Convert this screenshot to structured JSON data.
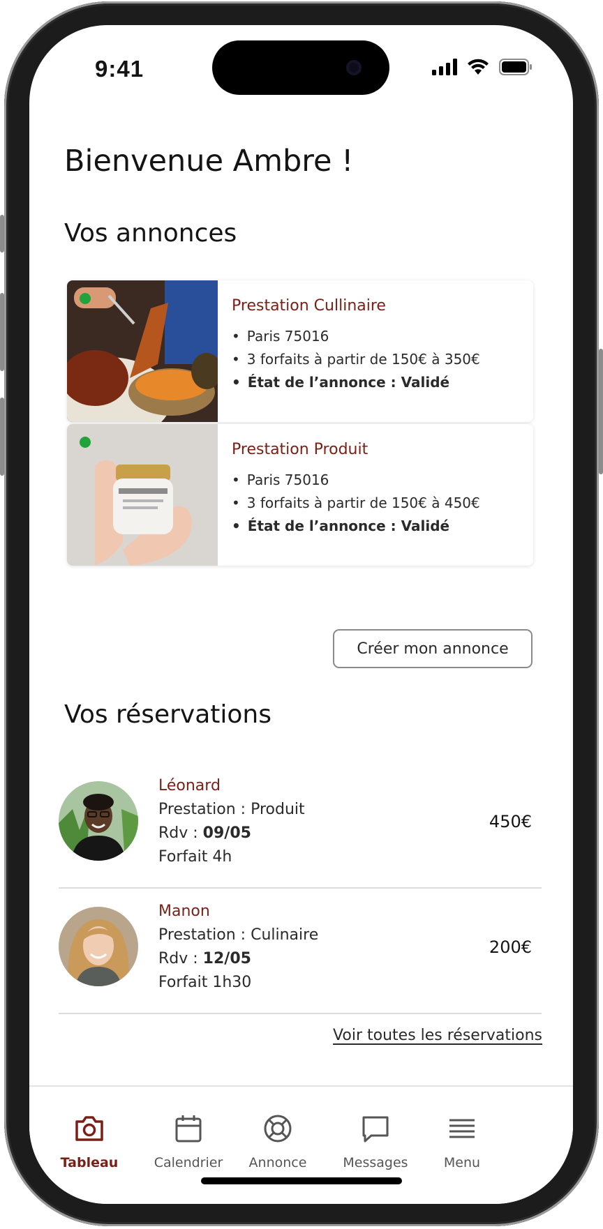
{
  "status": {
    "time": "9:41"
  },
  "welcome": "Bienvenue Ambre !",
  "listings_section": "Vos annonces",
  "listings": [
    {
      "title": "Prestation Cullinaire",
      "location": "Paris 75016",
      "packages": "3 forfaits à partir de 150€ à 350€",
      "state": "État de l’annonce : Validé",
      "status_color": "#1fa33a"
    },
    {
      "title": "Prestation Produit",
      "location": "Paris 75016",
      "packages": "3 forfaits à partir de 150€ à 450€",
      "state": "État de l’annonce : Validé",
      "status_color": "#1fa33a"
    }
  ],
  "create_button": "Créer mon annonce",
  "reservations_section": "Vos réservations",
  "reservations": [
    {
      "name": "Léonard",
      "service": "Prestation : Produit",
      "rdv_label": "Rdv : ",
      "rdv_date": "09/05",
      "package": "Forfait 4h",
      "price": "450€"
    },
    {
      "name": "Manon",
      "service": "Prestation : Culinaire",
      "rdv_label": "Rdv : ",
      "rdv_date": "12/05",
      "package": "Forfait 1h30",
      "price": "200€"
    }
  ],
  "see_all": "Voir toutes les réservations",
  "tabs": [
    {
      "label": "Tableau",
      "icon": "camera-icon",
      "active": true
    },
    {
      "label": "Calendrier",
      "icon": "calendar-icon",
      "active": false
    },
    {
      "label": "Annonce",
      "icon": "lifebuoy-icon",
      "active": false
    },
    {
      "label": "Messages",
      "icon": "message-icon",
      "active": false
    },
    {
      "label": "Menu",
      "icon": "menu-icon",
      "active": false
    }
  ],
  "colors": {
    "accent": "#7a1f16",
    "status_green": "#1fa33a"
  }
}
